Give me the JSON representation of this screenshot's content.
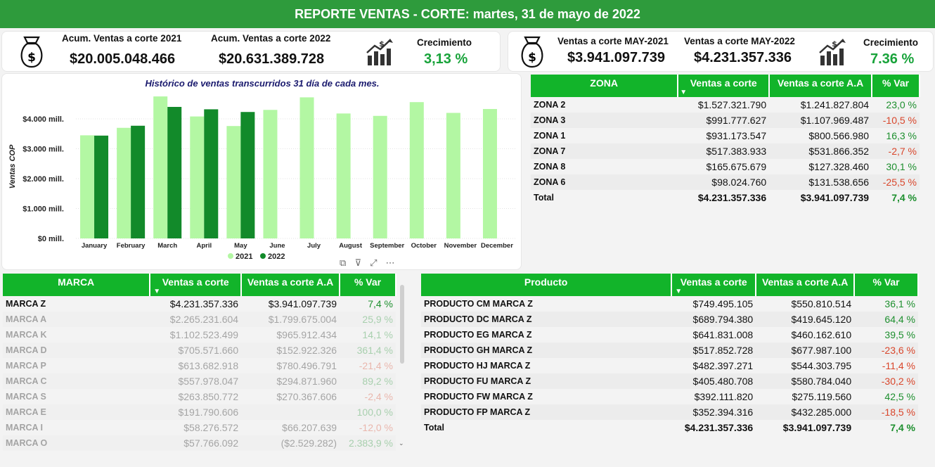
{
  "header": {
    "title": "REPORTE VENTAS - CORTE:  martes, 31 de mayo de 2022"
  },
  "kpi_left": {
    "label_2021": "Acum. Ventas a corte 2021",
    "value_2021": "$20.005.048.466",
    "label_2022": "Acum. Ventas a corte 2022",
    "value_2022": "$20.631.389.728",
    "growth_label": "Crecimiento",
    "growth_value": "3,13 %"
  },
  "kpi_right": {
    "label_2021": "Ventas a corte MAY-2021",
    "value_2021": "$3.941.097.739",
    "label_2022": "Ventas a corte MAY-2022",
    "value_2022": "$4.231.357.336",
    "growth_label": "Crecimiento",
    "growth_value": "7.36 %"
  },
  "chart_data": {
    "type": "bar",
    "title": "Histórico de ventas transcurridos 31 día de cada mes.",
    "ylabel": "Ventas COP",
    "xlabel": "",
    "ylim": [
      0,
      4800
    ],
    "y_ticks": [
      "$0 mill.",
      "$1.000 mill.",
      "$2.000 mill.",
      "$3.000 mill.",
      "$4.000 mill."
    ],
    "y_tick_values": [
      0,
      1000,
      2000,
      3000,
      4000
    ],
    "categories": [
      "January",
      "February",
      "March",
      "April",
      "May",
      "June",
      "July",
      "August",
      "September",
      "October",
      "November",
      "December"
    ],
    "series": [
      {
        "name": "2021",
        "color": "#b3f7a3",
        "values": [
          3450,
          3700,
          4750,
          4080,
          3760,
          4300,
          4720,
          4180,
          4100,
          4560,
          4200,
          4330
        ]
      },
      {
        "name": "2022",
        "color": "#128a2a",
        "values": [
          3440,
          3770,
          4400,
          4320,
          4230,
          null,
          null,
          null,
          null,
          null,
          null,
          null
        ]
      }
    ],
    "legend": "bottom-center"
  },
  "zona": {
    "headers": [
      "ZONA",
      "Ventas a corte",
      "Ventas a corte A.A",
      "% Var"
    ],
    "rows": [
      {
        "name": "ZONA 2",
        "v": "$1.527.321.790",
        "aa": "$1.241.827.804",
        "var": "23,0 %",
        "sign": "pos"
      },
      {
        "name": "ZONA 3",
        "v": "$991.777.627",
        "aa": "$1.107.969.487",
        "var": "-10,5 %",
        "sign": "neg"
      },
      {
        "name": "ZONA 1",
        "v": "$931.173.547",
        "aa": "$800.566.980",
        "var": "16,3 %",
        "sign": "pos"
      },
      {
        "name": "ZONA 7",
        "v": "$517.383.933",
        "aa": "$531.866.352",
        "var": "-2,7 %",
        "sign": "neg"
      },
      {
        "name": "ZONA 8",
        "v": "$165.675.679",
        "aa": "$127.328.460",
        "var": "30,1 %",
        "sign": "pos"
      },
      {
        "name": "ZONA 6",
        "v": "$98.024.760",
        "aa": "$131.538.656",
        "var": "-25,5 %",
        "sign": "neg"
      }
    ],
    "total": {
      "name": "Total",
      "v": "$4.231.357.336",
      "aa": "$3.941.097.739",
      "var": "7,4 %"
    }
  },
  "marca": {
    "headers": [
      "MARCA",
      "Ventas a corte",
      "Ventas a corte A.A",
      "% Var"
    ],
    "rows": [
      {
        "name": "MARCA Z",
        "v": "$4.231.357.336",
        "aa": "$3.941.097.739",
        "var": "7,4 %",
        "sign": "pos"
      },
      {
        "name": "MARCA A",
        "v": "$2.265.231.604",
        "aa": "$1.799.675.004",
        "var": "25,9 %",
        "sign": "pos"
      },
      {
        "name": "MARCA K",
        "v": "$1.102.523.499",
        "aa": "$965.912.434",
        "var": "14,1 %",
        "sign": "pos"
      },
      {
        "name": "MARCA D",
        "v": "$705.571.660",
        "aa": "$152.922.326",
        "var": "361,4 %",
        "sign": "pos"
      },
      {
        "name": "MARCA P",
        "v": "$613.682.918",
        "aa": "$780.496.791",
        "var": "-21,4 %",
        "sign": "neg"
      },
      {
        "name": "MARCA C",
        "v": "$557.978.047",
        "aa": "$294.871.960",
        "var": "89,2 %",
        "sign": "pos"
      },
      {
        "name": "MARCA S",
        "v": "$263.850.772",
        "aa": "$270.367.606",
        "var": "-2,4 %",
        "sign": "neg"
      },
      {
        "name": "MARCA E",
        "v": "$191.790.606",
        "aa": "",
        "var": "100,0 %",
        "sign": "pos"
      },
      {
        "name": "MARCA I",
        "v": "$58.276.572",
        "aa": "$66.207.639",
        "var": "-12,0 %",
        "sign": "neg"
      },
      {
        "name": "MARCA O",
        "v": "$57.766.092",
        "aa": "($2.529.282)",
        "var": "2.383,9 %",
        "sign": "pos"
      }
    ]
  },
  "producto": {
    "headers": [
      "Producto",
      "Ventas a corte",
      "Ventas a corte A.A",
      "% Var"
    ],
    "rows": [
      {
        "name": "PRODUCTO CM MARCA Z",
        "v": "$749.495.105",
        "aa": "$550.810.514",
        "var": "36,1 %",
        "sign": "pos"
      },
      {
        "name": "PRODUCTO DC MARCA Z",
        "v": "$689.794.380",
        "aa": "$419.645.120",
        "var": "64,4 %",
        "sign": "pos"
      },
      {
        "name": "PRODUCTO EG MARCA Z",
        "v": "$641.831.008",
        "aa": "$460.162.610",
        "var": "39,5 %",
        "sign": "pos"
      },
      {
        "name": "PRODUCTO GH MARCA Z",
        "v": "$517.852.728",
        "aa": "$677.987.100",
        "var": "-23,6 %",
        "sign": "neg"
      },
      {
        "name": "PRODUCTO HJ MARCA Z",
        "v": "$482.397.271",
        "aa": "$544.303.795",
        "var": "-11,4 %",
        "sign": "neg"
      },
      {
        "name": "PRODUCTO FU MARCA Z",
        "v": "$405.480.708",
        "aa": "$580.784.040",
        "var": "-30,2 %",
        "sign": "neg"
      },
      {
        "name": "PRODUCTO FW MARCA Z",
        "v": "$392.111.820",
        "aa": "$275.119.560",
        "var": "42,5 %",
        "sign": "pos"
      },
      {
        "name": "PRODUCTO FP MARCA Z",
        "v": "$352.394.316",
        "aa": "$432.285.000",
        "var": "-18,5 %",
        "sign": "neg"
      }
    ],
    "total": {
      "name": "Total",
      "v": "$4.231.357.336",
      "aa": "$3.941.097.739",
      "var": "7,4 %"
    }
  }
}
